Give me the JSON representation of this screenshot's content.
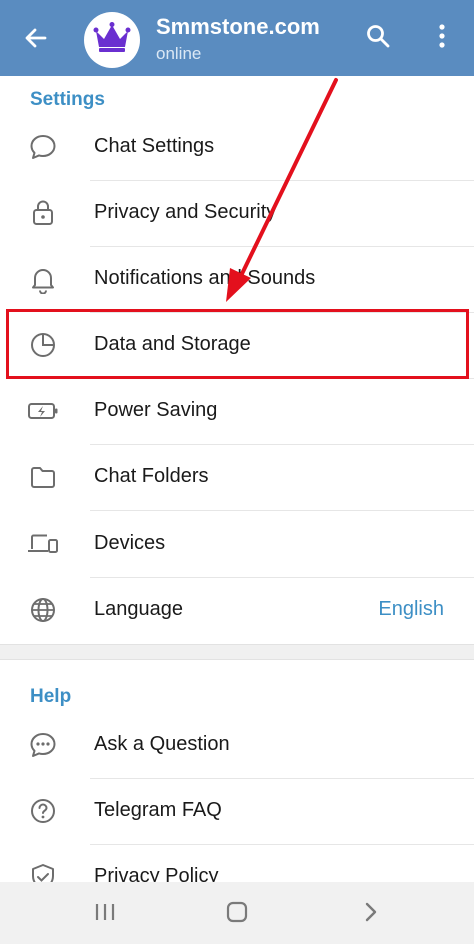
{
  "header": {
    "title": "Smmstone.com",
    "status": "online",
    "back_icon": "arrow-left-icon",
    "search_icon": "search-icon",
    "more_icon": "more-vertical-icon",
    "avatar_icon": "crown-icon",
    "background_color": "#5a8cc0",
    "avatar_crown_color": "#6a2fd0"
  },
  "settings": {
    "section_title": "Settings",
    "items": [
      {
        "label": "Chat Settings",
        "icon": "chat-bubble-icon"
      },
      {
        "label": "Privacy and Security",
        "icon": "lock-icon"
      },
      {
        "label": "Notifications and Sounds",
        "icon": "bell-icon"
      },
      {
        "label": "Data and Storage",
        "icon": "pie-chart-icon"
      },
      {
        "label": "Power Saving",
        "icon": "battery-icon"
      },
      {
        "label": "Chat Folders",
        "icon": "folder-icon"
      },
      {
        "label": "Devices",
        "icon": "devices-icon"
      },
      {
        "label": "Language",
        "icon": "globe-icon",
        "value": "English"
      }
    ]
  },
  "help": {
    "section_title": "Help",
    "items": [
      {
        "label": "Ask a Question",
        "icon": "chat-dots-icon"
      },
      {
        "label": "Telegram FAQ",
        "icon": "question-circle-icon"
      },
      {
        "label": "Privacy Policy",
        "icon": "shield-check-icon"
      }
    ]
  },
  "annotation": {
    "highlight_color": "#e3101d",
    "arrow_color": "#e3101d"
  },
  "navbar": {
    "recents_icon": "recents-icon",
    "home_icon": "home-icon",
    "back_icon": "chevron-right-icon"
  },
  "accent_color": "#3d8fc5"
}
